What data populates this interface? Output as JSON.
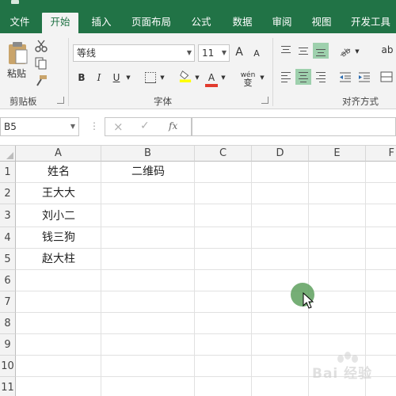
{
  "ribbon_tabs": [
    "文件",
    "开始",
    "插入",
    "页面布局",
    "公式",
    "数据",
    "审阅",
    "视图",
    "开发工具"
  ],
  "clipboard": {
    "paste_label": "粘贴",
    "group_label": "剪贴板"
  },
  "font": {
    "font_name": "等线",
    "font_size": "11",
    "group_label": "字体",
    "bold": "B",
    "italic": "I",
    "underline": "U",
    "grow": "A",
    "shrink": "A",
    "font_color": "A",
    "phonetic": "wén"
  },
  "alignment": {
    "group_label": "对齐方式"
  },
  "formula_bar": {
    "name_box": "B5",
    "fx": "fx",
    "cancel": "×",
    "enter": "✓",
    "formula": ""
  },
  "columns": [
    "A",
    "B",
    "C",
    "D",
    "E",
    "F"
  ],
  "rows": [
    "1",
    "2",
    "3",
    "4",
    "5",
    "6",
    "7",
    "8",
    "9",
    "10",
    "11"
  ],
  "cells": {
    "A1": "姓名",
    "B1": "二维码",
    "A2": "王大大",
    "A3": "刘小二",
    "A4": "钱三狗",
    "A5": "赵大柱"
  },
  "colors": {
    "accent": "#217346",
    "selected_align": "#9ed0ad",
    "cursor_ring": "#5ea05e"
  },
  "watermark": "Bai 经验"
}
